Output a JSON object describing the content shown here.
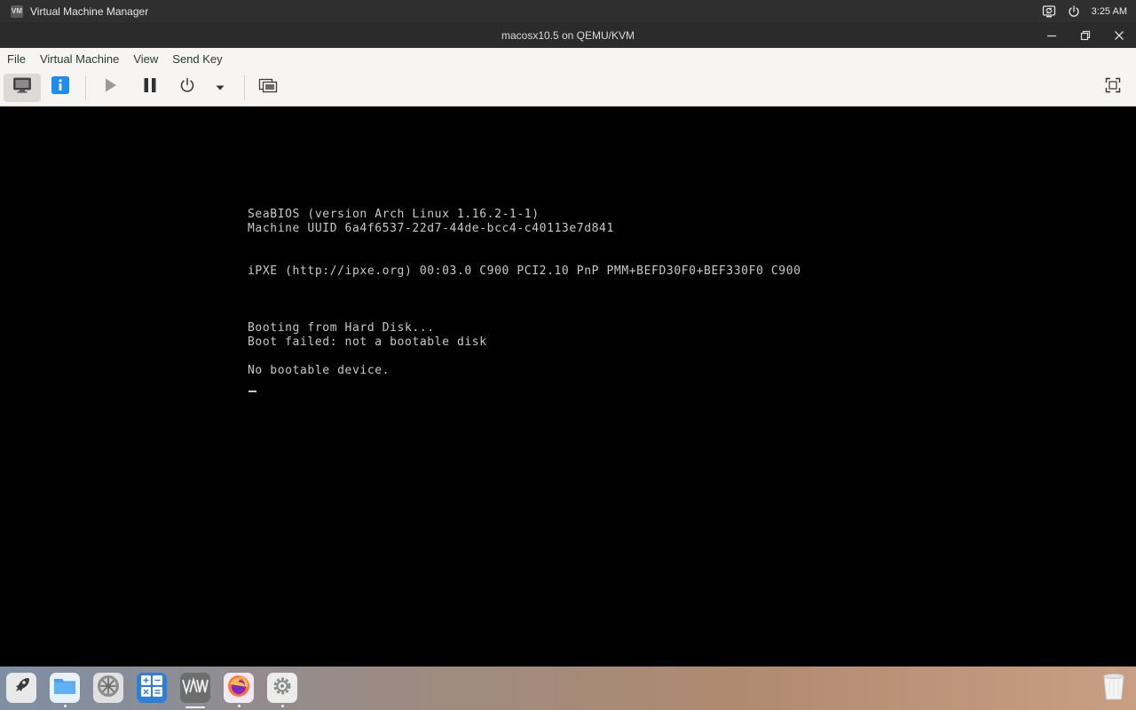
{
  "top_panel": {
    "app_name": "Virtual Machine Manager",
    "app_icon_glyph": "VM",
    "clock": "3:25 AM",
    "tray_icons": [
      "display-sync-icon",
      "power-icon"
    ]
  },
  "window": {
    "title": "macosx10.5 on QEMU/KVM"
  },
  "menu": {
    "items": [
      "File",
      "Virtual Machine",
      "View",
      "Send Key"
    ]
  },
  "toolbar": {
    "buttons": [
      "console-view-icon",
      "details-info-icon",
      "run-icon",
      "pause-icon",
      "shutdown-icon",
      "shutdown-menu-arrow-icon",
      "screenshot-icon",
      "fullscreen-icon"
    ],
    "active": "console-view-icon",
    "accent_color": "#1f8cf0"
  },
  "console": {
    "lines": [
      "SeaBIOS (version Arch Linux 1.16.2-1-1)",
      "Machine UUID 6a4f6537-22d7-44de-bcc4-c40113e7d841",
      "",
      "",
      "iPXE (http://ipxe.org) 00:03.0 C900 PCI2.10 PnP PMM+BEFD30F0+BEF330F0 C900",
      "",
      "",
      "",
      "Booting from Hard Disk...",
      "Boot failed: not a bootable disk",
      "",
      "No bootable device."
    ],
    "text_color": "#c8c8c8",
    "background": "#000000"
  },
  "dock": {
    "apps": [
      "launchpad-icon",
      "files-icon",
      "system-settings-icon",
      "calculator-icon",
      "virt-manager-icon",
      "firefox-icon",
      "settings-gear-icon"
    ],
    "trash": "trash-icon"
  }
}
